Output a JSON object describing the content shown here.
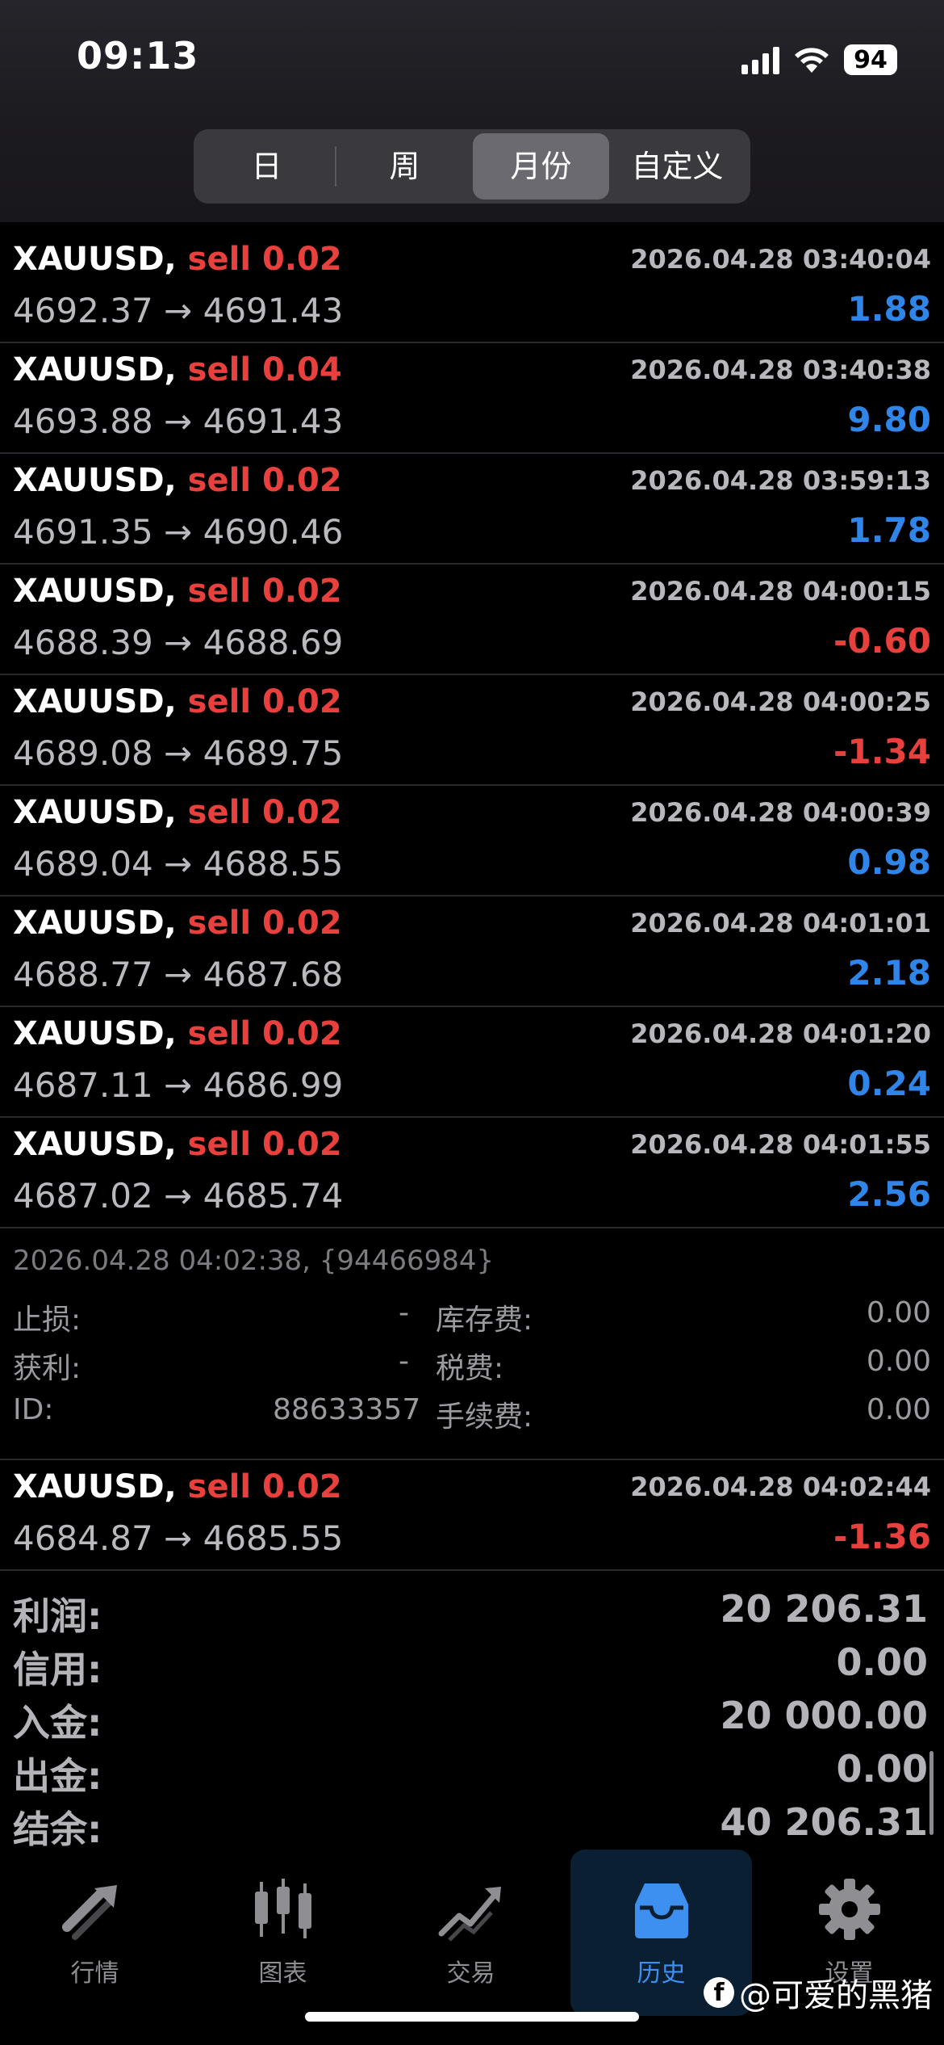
{
  "status_bar": {
    "time": "09:13",
    "battery": "94"
  },
  "period_tabs": [
    {
      "label": "日",
      "active": false
    },
    {
      "label": "周",
      "active": false
    },
    {
      "label": "月份",
      "active": true
    },
    {
      "label": "自定义",
      "active": false
    }
  ],
  "trades_before": [
    {
      "symbol": "XAUUSD,",
      "direction": "sell",
      "volume": "0.02",
      "time": "2026.04.28 03:40:04",
      "open": "4692.37",
      "close": "4691.43",
      "profit": "1.88",
      "negative": false
    },
    {
      "symbol": "XAUUSD,",
      "direction": "sell",
      "volume": "0.04",
      "time": "2026.04.28 03:40:38",
      "open": "4693.88",
      "close": "4691.43",
      "profit": "9.80",
      "negative": false
    },
    {
      "symbol": "XAUUSD,",
      "direction": "sell",
      "volume": "0.02",
      "time": "2026.04.28 03:59:13",
      "open": "4691.35",
      "close": "4690.46",
      "profit": "1.78",
      "negative": false
    },
    {
      "symbol": "XAUUSD,",
      "direction": "sell",
      "volume": "0.02",
      "time": "2026.04.28 04:00:15",
      "open": "4688.39",
      "close": "4688.69",
      "profit": "-0.60",
      "negative": true
    },
    {
      "symbol": "XAUUSD,",
      "direction": "sell",
      "volume": "0.02",
      "time": "2026.04.28 04:00:25",
      "open": "4689.08",
      "close": "4689.75",
      "profit": "-1.34",
      "negative": true
    },
    {
      "symbol": "XAUUSD,",
      "direction": "sell",
      "volume": "0.02",
      "time": "2026.04.28 04:00:39",
      "open": "4689.04",
      "close": "4688.55",
      "profit": "0.98",
      "negative": false
    },
    {
      "symbol": "XAUUSD,",
      "direction": "sell",
      "volume": "0.02",
      "time": "2026.04.28 04:01:01",
      "open": "4688.77",
      "close": "4687.68",
      "profit": "2.18",
      "negative": false
    },
    {
      "symbol": "XAUUSD,",
      "direction": "sell",
      "volume": "0.02",
      "time": "2026.04.28 04:01:20",
      "open": "4687.11",
      "close": "4686.99",
      "profit": "0.24",
      "negative": false
    },
    {
      "symbol": "XAUUSD,",
      "direction": "sell",
      "volume": "0.02",
      "time": "2026.04.28 04:01:55",
      "open": "4687.02",
      "close": "4685.74",
      "profit": "2.56",
      "negative": false
    }
  ],
  "trade_details": {
    "header": "2026.04.28 04:02:38, {94466984}",
    "stop_loss_label": "止损:",
    "stop_loss_value": "-",
    "take_profit_label": "获利:",
    "take_profit_value": "-",
    "id_label": "ID:",
    "id_value": "88633357",
    "swap_label": "库存费:",
    "swap_value": "0.00",
    "tax_label": "税费:",
    "tax_value": "0.00",
    "commission_label": "手续费:",
    "commission_value": "0.00"
  },
  "trades_after": [
    {
      "symbol": "XAUUSD,",
      "direction": "sell",
      "volume": "0.02",
      "time": "2026.04.28 04:02:44",
      "open": "4684.87",
      "close": "4685.55",
      "profit": "-1.36",
      "negative": true
    }
  ],
  "arrow": "→",
  "summary": [
    {
      "label": "利润:",
      "value": "20 206.31"
    },
    {
      "label": "信用:",
      "value": "0.00"
    },
    {
      "label": "入金:",
      "value": "20 000.00"
    },
    {
      "label": "出金:",
      "value": "0.00"
    },
    {
      "label": "结余:",
      "value": "40 206.31"
    }
  ],
  "bottom_tabs": [
    {
      "label": "行情",
      "icon": "quotes-icon",
      "active": false
    },
    {
      "label": "图表",
      "icon": "chart-icon",
      "active": false
    },
    {
      "label": "交易",
      "icon": "trade-icon",
      "active": false
    },
    {
      "label": "历史",
      "icon": "history-icon",
      "active": true
    },
    {
      "label": "设置",
      "icon": "settings-icon",
      "active": false
    }
  ],
  "watermark": "@可爱的黑猪",
  "colors": {
    "profit_positive": "#2f86e8",
    "profit_negative": "#e8413d",
    "direction": "#e8413d",
    "active_tab": "#3d8ff0"
  }
}
